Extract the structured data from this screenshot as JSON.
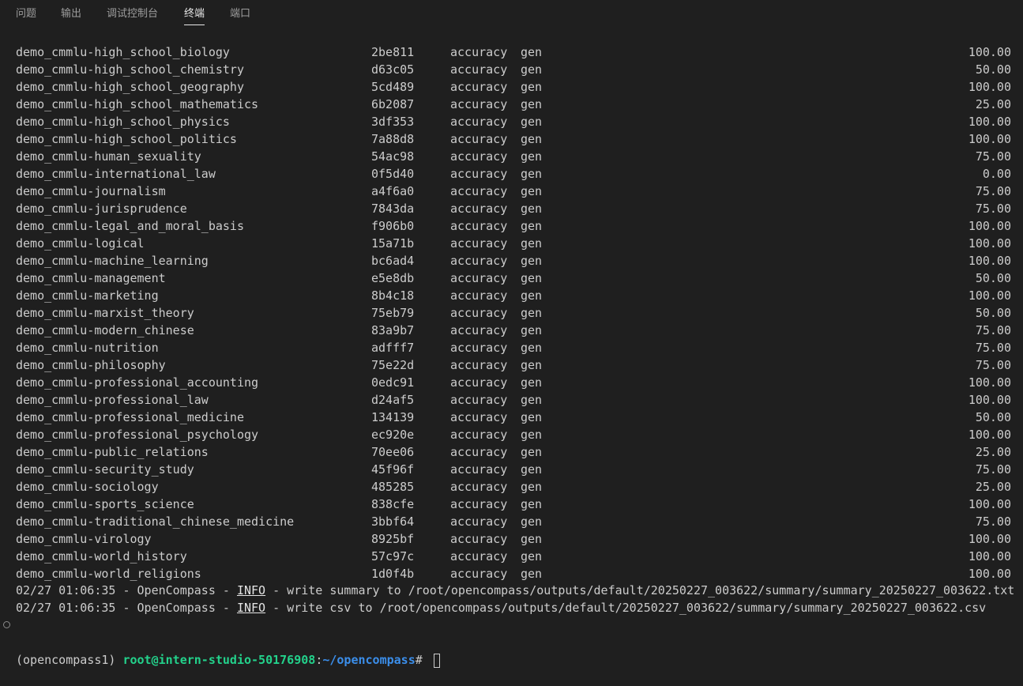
{
  "tabs": [
    {
      "label": "问题",
      "active": false
    },
    {
      "label": "输出",
      "active": false
    },
    {
      "label": "调试控制台",
      "active": false
    },
    {
      "label": "终端",
      "active": true
    },
    {
      "label": "端口",
      "active": false
    }
  ],
  "rows": [
    {
      "name": "demo_cmmlu-high_school_biology",
      "hash": "2be811",
      "metric": "accuracy",
      "mode": "gen",
      "score": "100.00"
    },
    {
      "name": "demo_cmmlu-high_school_chemistry",
      "hash": "d63c05",
      "metric": "accuracy",
      "mode": "gen",
      "score": "50.00"
    },
    {
      "name": "demo_cmmlu-high_school_geography",
      "hash": "5cd489",
      "metric": "accuracy",
      "mode": "gen",
      "score": "100.00"
    },
    {
      "name": "demo_cmmlu-high_school_mathematics",
      "hash": "6b2087",
      "metric": "accuracy",
      "mode": "gen",
      "score": "25.00"
    },
    {
      "name": "demo_cmmlu-high_school_physics",
      "hash": "3df353",
      "metric": "accuracy",
      "mode": "gen",
      "score": "100.00"
    },
    {
      "name": "demo_cmmlu-high_school_politics",
      "hash": "7a88d8",
      "metric": "accuracy",
      "mode": "gen",
      "score": "100.00"
    },
    {
      "name": "demo_cmmlu-human_sexuality",
      "hash": "54ac98",
      "metric": "accuracy",
      "mode": "gen",
      "score": "75.00"
    },
    {
      "name": "demo_cmmlu-international_law",
      "hash": "0f5d40",
      "metric": "accuracy",
      "mode": "gen",
      "score": "0.00"
    },
    {
      "name": "demo_cmmlu-journalism",
      "hash": "a4f6a0",
      "metric": "accuracy",
      "mode": "gen",
      "score": "75.00"
    },
    {
      "name": "demo_cmmlu-jurisprudence",
      "hash": "7843da",
      "metric": "accuracy",
      "mode": "gen",
      "score": "75.00"
    },
    {
      "name": "demo_cmmlu-legal_and_moral_basis",
      "hash": "f906b0",
      "metric": "accuracy",
      "mode": "gen",
      "score": "100.00"
    },
    {
      "name": "demo_cmmlu-logical",
      "hash": "15a71b",
      "metric": "accuracy",
      "mode": "gen",
      "score": "100.00"
    },
    {
      "name": "demo_cmmlu-machine_learning",
      "hash": "bc6ad4",
      "metric": "accuracy",
      "mode": "gen",
      "score": "100.00"
    },
    {
      "name": "demo_cmmlu-management",
      "hash": "e5e8db",
      "metric": "accuracy",
      "mode": "gen",
      "score": "50.00"
    },
    {
      "name": "demo_cmmlu-marketing",
      "hash": "8b4c18",
      "metric": "accuracy",
      "mode": "gen",
      "score": "100.00"
    },
    {
      "name": "demo_cmmlu-marxist_theory",
      "hash": "75eb79",
      "metric": "accuracy",
      "mode": "gen",
      "score": "50.00"
    },
    {
      "name": "demo_cmmlu-modern_chinese",
      "hash": "83a9b7",
      "metric": "accuracy",
      "mode": "gen",
      "score": "75.00"
    },
    {
      "name": "demo_cmmlu-nutrition",
      "hash": "adfff7",
      "metric": "accuracy",
      "mode": "gen",
      "score": "75.00"
    },
    {
      "name": "demo_cmmlu-philosophy",
      "hash": "75e22d",
      "metric": "accuracy",
      "mode": "gen",
      "score": "75.00"
    },
    {
      "name": "demo_cmmlu-professional_accounting",
      "hash": "0edc91",
      "metric": "accuracy",
      "mode": "gen",
      "score": "100.00"
    },
    {
      "name": "demo_cmmlu-professional_law",
      "hash": "d24af5",
      "metric": "accuracy",
      "mode": "gen",
      "score": "100.00"
    },
    {
      "name": "demo_cmmlu-professional_medicine",
      "hash": "134139",
      "metric": "accuracy",
      "mode": "gen",
      "score": "50.00"
    },
    {
      "name": "demo_cmmlu-professional_psychology",
      "hash": "ec920e",
      "metric": "accuracy",
      "mode": "gen",
      "score": "100.00"
    },
    {
      "name": "demo_cmmlu-public_relations",
      "hash": "70ee06",
      "metric": "accuracy",
      "mode": "gen",
      "score": "25.00"
    },
    {
      "name": "demo_cmmlu-security_study",
      "hash": "45f96f",
      "metric": "accuracy",
      "mode": "gen",
      "score": "75.00"
    },
    {
      "name": "demo_cmmlu-sociology",
      "hash": "485285",
      "metric": "accuracy",
      "mode": "gen",
      "score": "25.00"
    },
    {
      "name": "demo_cmmlu-sports_science",
      "hash": "838cfe",
      "metric": "accuracy",
      "mode": "gen",
      "score": "100.00"
    },
    {
      "name": "demo_cmmlu-traditional_chinese_medicine",
      "hash": "3bbf64",
      "metric": "accuracy",
      "mode": "gen",
      "score": "75.00"
    },
    {
      "name": "demo_cmmlu-virology",
      "hash": "8925bf",
      "metric": "accuracy",
      "mode": "gen",
      "score": "100.00"
    },
    {
      "name": "demo_cmmlu-world_history",
      "hash": "57c97c",
      "metric": "accuracy",
      "mode": "gen",
      "score": "100.00"
    },
    {
      "name": "demo_cmmlu-world_religions",
      "hash": "1d0f4b",
      "metric": "accuracy",
      "mode": "gen",
      "score": "100.00"
    }
  ],
  "logs": [
    {
      "prefix": "02/27 01:06:35 - OpenCompass - ",
      "level": "INFO",
      "message": " - write summary to /root/opencompass/outputs/default/20250227_003622/summary/summary_20250227_003622.txt"
    },
    {
      "prefix": "02/27 01:06:35 - OpenCompass - ",
      "level": "INFO",
      "message": " - write csv to /root/opencompass/outputs/default/20250227_003622/summary/summary_20250227_003622.csv"
    }
  ],
  "prompt": {
    "env": "(opencompass1) ",
    "user": "root@intern-studio-50176908",
    "colon": ":",
    "path": "~/opencompass",
    "symbol": "# "
  },
  "colors": {
    "background": "#1f1f1f",
    "text": "#cccccc",
    "prompt_user": "#23d18b",
    "prompt_path": "#3b8eea"
  }
}
